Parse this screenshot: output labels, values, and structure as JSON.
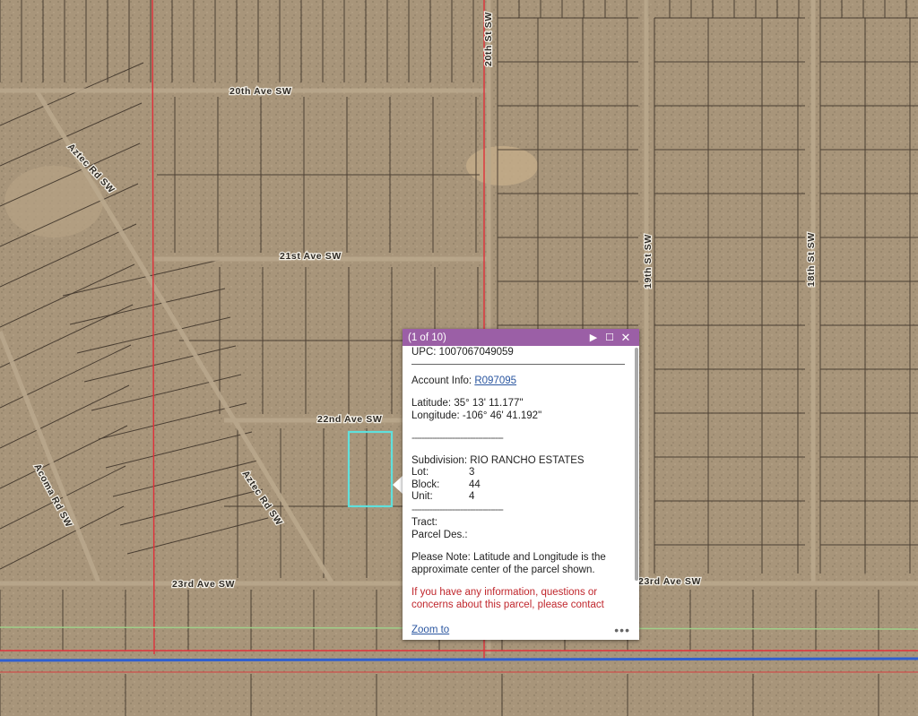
{
  "map": {
    "roads": {
      "ave_20": "20th Ave SW",
      "ave_21": "21st Ave SW",
      "ave_22": "22nd Ave SW",
      "ave_23_left": "23rd Ave SW",
      "ave_23_right": "23rd Ave SW",
      "st_20": "20th St SW",
      "st_19": "19th St SW",
      "st_18": "18th St SW",
      "aztec_upper": "Aztec Rd SW",
      "aztec_lower": "Aztec Rd SW",
      "acoma": "Acoma Rd SW"
    },
    "colors": {
      "terrain": "#a8957a",
      "parcel_lines": "#3a3026",
      "highlight": "#5fe0dc",
      "red_boundary": "#e0303a",
      "blue_line": "#2f5fd0",
      "green_line": "#9fd08a"
    }
  },
  "popup": {
    "counter": "(1 of 10)",
    "icons": {
      "next": "next-icon",
      "maximize": "maximize-icon",
      "close": "close-icon"
    },
    "upc": "UPC: 1007067049059",
    "account_label": "Account Info: ",
    "account_link": "R097095",
    "latitude": "Latitude: 35° 13' 11.177\"",
    "longitude": "Longitude: -106° 46' 41.192\"",
    "divider": "------------------------------------",
    "subdivision": "Subdivision: RIO RANCHO ESTATES",
    "lot_label": "Lot:",
    "lot_value": "3",
    "block_label": "Block:",
    "block_value": "44",
    "unit_label": "Unit:",
    "unit_value": "4",
    "tract": "Tract:",
    "parcel_des": "Parcel Des.:",
    "note": "Please Note: Latitude and Longitude is the approximate center of the parcel shown.",
    "contact": "If you have any information, questions or concerns about this parcel, please contact",
    "zoom_to": "Zoom to",
    "more": "•••"
  }
}
